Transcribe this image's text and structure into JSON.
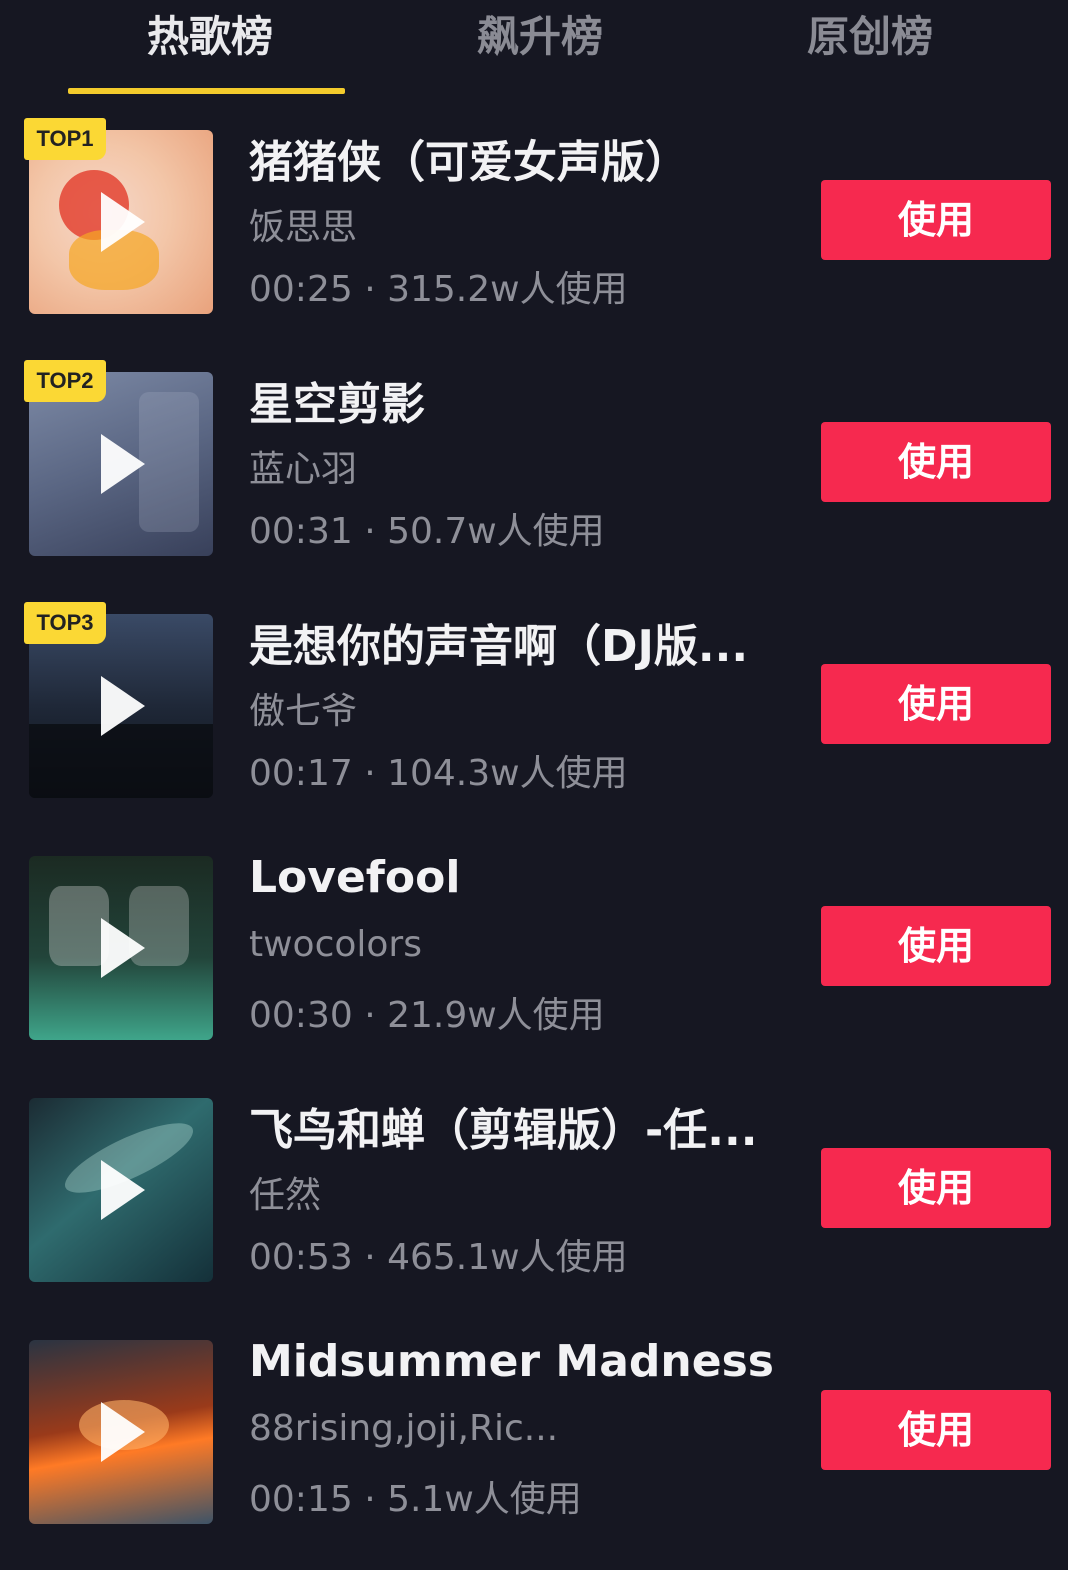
{
  "tabs": [
    {
      "label": "热歌榜",
      "active": true
    },
    {
      "label": "飙升榜",
      "active": false
    },
    {
      "label": "原创榜",
      "active": false
    }
  ],
  "accent_color": "#f3cb2c",
  "button_color": "#f6294f",
  "songs": [
    {
      "rank_badge": "TOP1",
      "title": "猪猪侠（可爱女声版）",
      "artist": "饭思思",
      "meta": "00:25 · 315.2w人使用",
      "use_label": "使用"
    },
    {
      "rank_badge": "TOP2",
      "title": "星空剪影",
      "artist": "蓝心羽",
      "meta": "00:31 · 50.7w人使用",
      "use_label": "使用"
    },
    {
      "rank_badge": "TOP3",
      "title": "是想你的声音啊（DJ版...",
      "artist": "傲七爷",
      "meta": "00:17 · 104.3w人使用",
      "use_label": "使用"
    },
    {
      "rank_badge": "",
      "title": "Lovefool",
      "artist": "twocolors",
      "meta": "00:30 · 21.9w人使用",
      "use_label": "使用"
    },
    {
      "rank_badge": "",
      "title": "飞鸟和蝉（剪辑版）-任...",
      "artist": "任然",
      "meta": "00:53 · 465.1w人使用",
      "use_label": "使用"
    },
    {
      "rank_badge": "",
      "title": "Midsummer Madness",
      "artist": "88rising,joji,Ric...",
      "meta": "00:15 · 5.1w人使用",
      "use_label": "使用"
    }
  ]
}
